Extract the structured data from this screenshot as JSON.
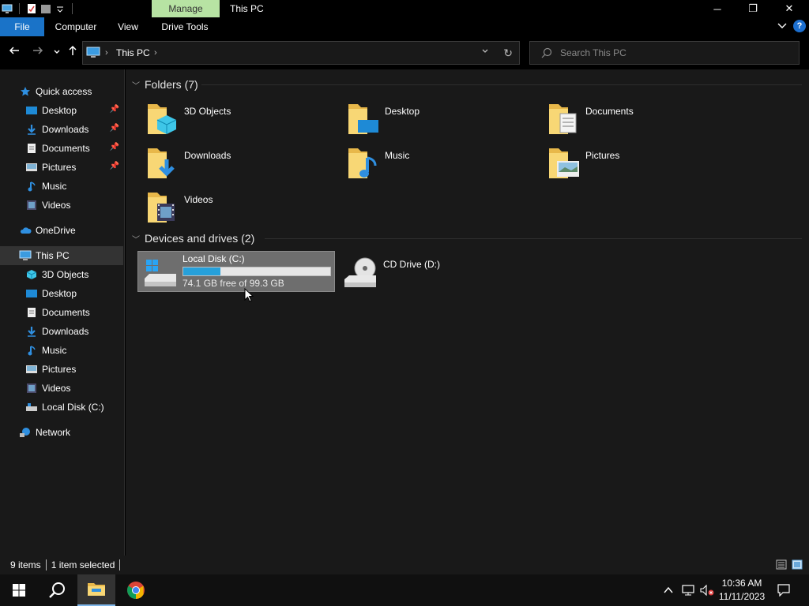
{
  "window": {
    "title": "This PC",
    "context_tab": "Manage",
    "controls": {
      "minimize": "─",
      "restore": "❐",
      "close": "✕"
    }
  },
  "ribbon": {
    "tabs": [
      "File",
      "Computer",
      "View",
      "Drive Tools"
    ],
    "expand_icon": "chevron-down-icon",
    "help_label": "?"
  },
  "address": {
    "breadcrumb": [
      "This PC"
    ],
    "search_placeholder": "Search This PC"
  },
  "nav_pane": {
    "quick_access": {
      "label": "Quick access",
      "items": [
        {
          "label": "Desktop",
          "pinned": true
        },
        {
          "label": "Downloads",
          "pinned": true
        },
        {
          "label": "Documents",
          "pinned": true
        },
        {
          "label": "Pictures",
          "pinned": true
        },
        {
          "label": "Music",
          "pinned": false
        },
        {
          "label": "Videos",
          "pinned": false
        }
      ]
    },
    "onedrive": "OneDrive",
    "this_pc": {
      "label": "This PC",
      "items": [
        "3D Objects",
        "Desktop",
        "Documents",
        "Downloads",
        "Music",
        "Pictures",
        "Videos",
        "Local Disk (C:)"
      ]
    },
    "network": "Network"
  },
  "content": {
    "folders_header": "Folders (7)",
    "folders": [
      "3D Objects",
      "Desktop",
      "Documents",
      "Downloads",
      "Music",
      "Pictures",
      "Videos"
    ],
    "devices_header": "Devices and drives (2)",
    "drives": {
      "local_disk": {
        "name": "Local Disk (C:)",
        "free_text": "74.1 GB free of 99.3 GB",
        "used_fraction": 0.254
      },
      "cd_drive": {
        "name": "CD Drive (D:)"
      }
    }
  },
  "status_bar": {
    "items_count": "9 items",
    "selection": "1 item selected"
  },
  "taskbar": {
    "time": "10:36 AM",
    "date": "11/11/2023",
    "tray_icons": [
      "chevron-up-icon",
      "network-icon",
      "volume-muted-icon",
      "notification-icon"
    ]
  },
  "colors": {
    "accent": "#1a73c8",
    "manage_tab": "#b7e3a3",
    "progress": "#26a0da",
    "background": "#191919"
  }
}
